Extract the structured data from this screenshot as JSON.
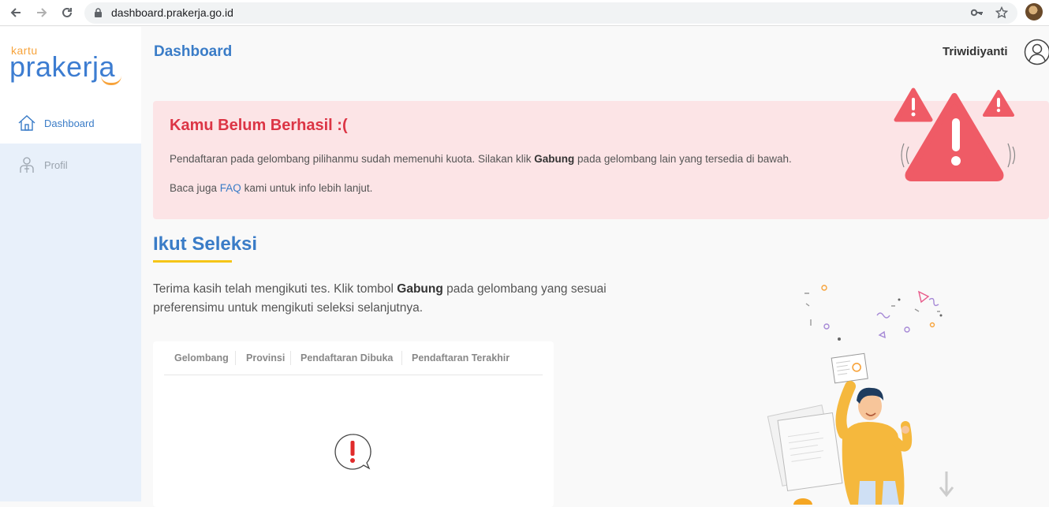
{
  "browser": {
    "url": "dashboard.prakerja.go.id"
  },
  "sidebar": {
    "logo_small": "kartu",
    "logo_big": "prakerja",
    "items": [
      {
        "label": "Dashboard",
        "icon": "home-icon",
        "active": true
      },
      {
        "label": "Profil",
        "icon": "profile-icon",
        "active": false
      }
    ]
  },
  "header": {
    "title": "Dashboard",
    "user_name": "Triwidiyanti"
  },
  "alert": {
    "title": "Kamu Belum Berhasil :(",
    "line1_before": "Pendaftaran pada gelombang pilihanmu sudah memenuhi kuota. Silakan klik ",
    "line1_bold": "Gabung",
    "line1_after": " pada gelombang lain yang tersedia di bawah.",
    "line2_before": "Baca juga ",
    "line2_link": "FAQ",
    "line2_after": " kami untuk info lebih lanjut."
  },
  "seleksi": {
    "title": "Ikut Seleksi",
    "desc_before": "Terima kasih telah mengikuti tes. Klik tombol ",
    "desc_bold": "Gabung",
    "desc_after": " pada gelombang yang sesuai preferensimu untuk mengikuti seleksi selanjutnya.",
    "table_headers": [
      "Gelombang",
      "Provinsi",
      "Pendaftaran Dibuka",
      "Pendaftaran Terakhir"
    ]
  },
  "colors": {
    "accent_blue": "#3a7cc7",
    "alert_red": "#dc3545",
    "alert_bg": "#fce4e6",
    "underline_yellow": "#f5c518"
  }
}
